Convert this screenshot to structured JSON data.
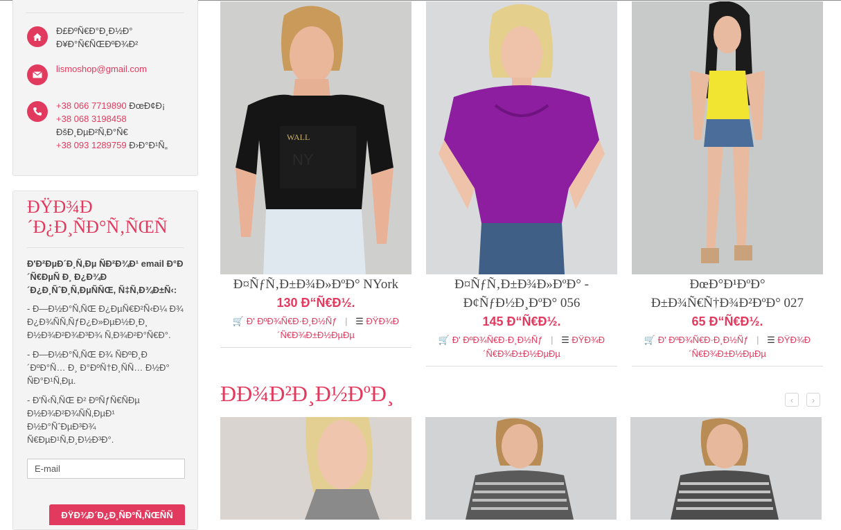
{
  "contacts": {
    "address": "Ð£ÐºÑ€Ð°Ð¸Ð½Ð° Ð¥Ð°Ñ€ÑŒÐºÐ¾Ð²",
    "email": "lismoshop@gmail.com",
    "phones": [
      {
        "number": "+38 066 7719890",
        "label": "ÐœÐ¢Ð¡"
      },
      {
        "number": "+38 068 3198458",
        "label": "ÐšÐ¸ÐµÐ²Ñ‚Ð°Ñ€"
      },
      {
        "number": "+38 093 1289759",
        "label": "Ð›Ð°Ð¹Ñ„"
      }
    ]
  },
  "subscribe": {
    "title": "ÐŸÐ¾Ð´Ð¿Ð¸ÑÐ°Ñ‚ÑŒÑ",
    "lead": "Ð'Ð²ÐµÐ´Ð¸Ñ‚Ðµ ÑÐ²Ð¾Ð¹ email Ð°Ð´Ñ€ÐµÑ Ð¸ Ð¿Ð¾Ð´Ð¿Ð¸ÑˆÐ¸Ñ‚ÐµÑÑŒ, Ñ‡Ñ‚Ð¾Ð±Ñ‹:",
    "items": [
      "- Ð—Ð½Ð°Ñ‚ÑŒ Ð¿ÐµÑ€Ð²Ñ‹Ð¼ Ð¾ Ð¿Ð¾ÑÑ‚ÑƒÐ¿Ð»ÐµÐ½Ð¸Ð¸ Ð½Ð¾Ð²Ð¾Ð³Ð¾ Ñ‚Ð¾Ð²Ð°Ñ€Ð°.",
      "- Ð—Ð½Ð°Ñ‚ÑŒ Ð¾ ÑÐºÐ¸Ð´ÐºÐ°Ñ… Ð¸ Ð°ÐºÑ†Ð¸ÑÑ… Ð½Ð° ÑÐ°Ð¹Ñ‚Ðµ.",
      "- Ð'Ñ‹Ñ‚ÑŒ Ð² ÐºÑƒÑ€ÑÐµ Ð½Ð¾Ð²Ð¾ÑÑ‚ÐµÐ¹ Ð½Ð°ÑˆÐµÐ³Ð¾ Ñ€ÐµÐ¹Ñ‚Ð¸Ð½Ð³Ð°."
    ],
    "placeholder": "E-mail",
    "button": "ÐŸÐ¾Ð´Ð¿Ð¸ÑÐ°Ñ‚ÑŒÑÑ"
  },
  "products": [
    {
      "name": "Ð¤ÑƒÑ‚Ð±Ð¾Ð»ÐºÐ° NYork",
      "price": "130 Ð“Ñ€Ð½.",
      "cart": "Ð' ÐºÐ¾Ñ€Ð·Ð¸Ð½Ñƒ",
      "details": "ÐŸÐ¾Ð´Ñ€Ð¾Ð±Ð½ÐµÐµ"
    },
    {
      "name": "Ð¤ÑƒÑ‚Ð±Ð¾Ð»ÐºÐ° - Ð¢ÑƒÐ½Ð¸ÐºÐ° 056",
      "price": "145 Ð“Ñ€Ð½.",
      "cart": "Ð' ÐºÐ¾Ñ€Ð·Ð¸Ð½Ñƒ",
      "details": "ÐŸÐ¾Ð´Ñ€Ð¾Ð±Ð½ÐµÐµ"
    },
    {
      "name": "ÐœÐ°Ð¹ÐºÐ° Ð±Ð¾Ñ€Ñ†Ð¾Ð²ÐºÐ° 027",
      "price": "65 Ð“Ñ€Ð½.",
      "cart": "Ð' ÐºÐ¾Ñ€Ð·Ð¸Ð½Ñƒ",
      "details": "ÐŸÐ¾Ð´Ñ€Ð¾Ð±Ð½ÐµÐµ"
    }
  ],
  "new_section": {
    "title": "ÐÐ¾Ð²Ð¸Ð½ÐºÐ¸"
  },
  "colors": {
    "accent": "#e23a5e"
  }
}
